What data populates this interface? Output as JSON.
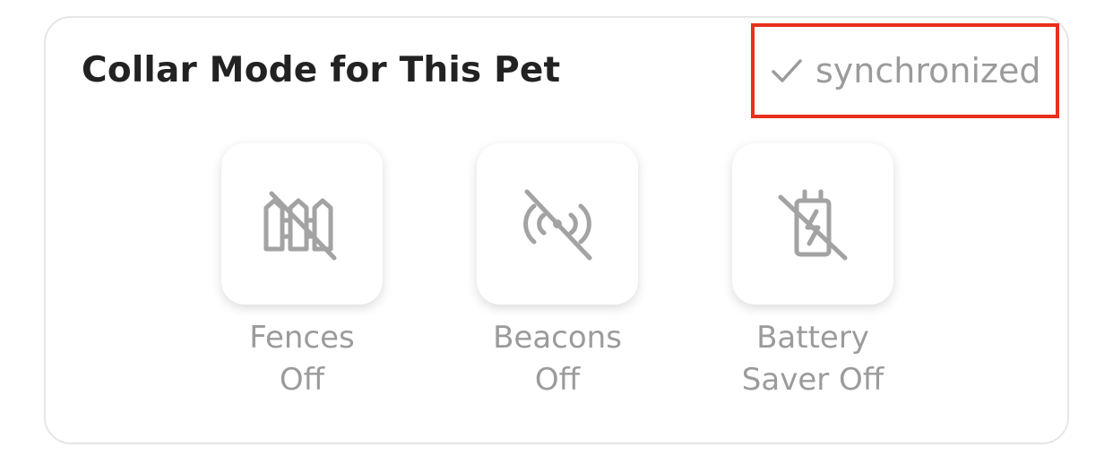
{
  "card": {
    "title": "Collar Mode for This Pet",
    "sync_status": {
      "label": "synchronized",
      "icon": "check-icon"
    }
  },
  "modes": [
    {
      "icon": "fence-off-icon",
      "line1": "Fences",
      "line2": "Off"
    },
    {
      "icon": "beacon-off-icon",
      "line1": "Beacons",
      "line2": "Off"
    },
    {
      "icon": "battery-saver-off-icon",
      "line1": "Battery",
      "line2": "Saver Off"
    }
  ],
  "colors": {
    "title": "#222222",
    "muted": "#9b9b9b",
    "highlight_border": "#e8301c",
    "card_border": "#e6e6e6"
  }
}
